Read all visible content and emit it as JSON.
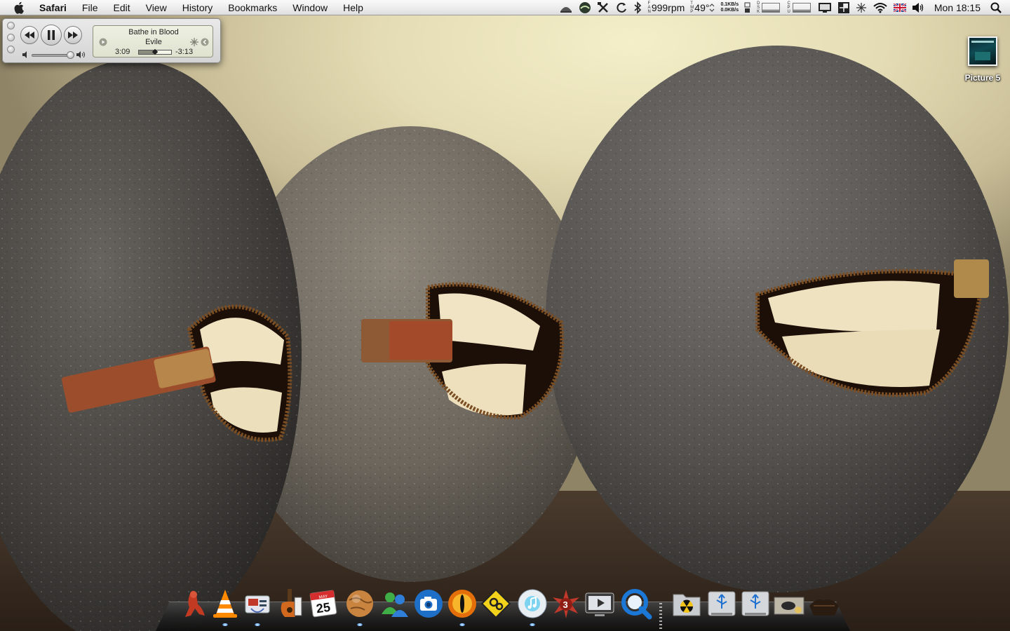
{
  "menubar": {
    "apple_icon": "apple-icon",
    "app_name": "Safari",
    "items": [
      "File",
      "Edit",
      "View",
      "History",
      "Bookmarks",
      "Window",
      "Help"
    ],
    "status": {
      "fan_label_letters": [
        "F",
        "A",
        "N"
      ],
      "fan_speed": "999rpm",
      "temp_label_letters": [
        "T",
        "M",
        "P"
      ],
      "temperature": "49°",
      "net_up": "0.1KB/s",
      "net_down": "0.0KB/s",
      "disk_label_letters": [
        "D",
        "S",
        "K"
      ],
      "cpu_label_letters": [
        "C",
        "P",
        "U"
      ],
      "clock": "Mon 18:15"
    }
  },
  "mini_player": {
    "track_title": "Bathe in Blood",
    "artist": "Evile",
    "elapsed": "3:09",
    "remaining": "-3:13",
    "progress_fraction": 0.49,
    "volume_fraction": 0.85
  },
  "desktop_icons": [
    {
      "label": "Picture 5"
    }
  ],
  "dock": {
    "items": [
      {
        "name": "character-app-icon",
        "running": false
      },
      {
        "name": "vlc-icon",
        "running": true
      },
      {
        "name": "mail-stamp-icon",
        "running": true
      },
      {
        "name": "garageband-icon",
        "running": false
      },
      {
        "name": "ical-icon",
        "running": false,
        "calendar_month": "MAY",
        "calendar_day": "25"
      },
      {
        "name": "globe-icon",
        "running": true
      },
      {
        "name": "messenger-icon",
        "running": false
      },
      {
        "name": "camera-icon",
        "running": false
      },
      {
        "name": "eye-icon",
        "running": true
      },
      {
        "name": "automator-sign-icon",
        "running": false
      },
      {
        "name": "itunes-disc-icon",
        "running": true
      },
      {
        "name": "badge-icon",
        "running": false,
        "badge_number": "3"
      },
      {
        "name": "front-row-icon",
        "running": false
      },
      {
        "name": "quicktime-icon",
        "running": false
      },
      {
        "name": "radioactive-folder-icon",
        "running": false
      },
      {
        "name": "usb-drive-icon",
        "running": false
      },
      {
        "name": "usb-drive-2-icon",
        "running": false
      },
      {
        "name": "box-items-icon",
        "running": false
      },
      {
        "name": "trash-icon",
        "running": false
      }
    ]
  }
}
